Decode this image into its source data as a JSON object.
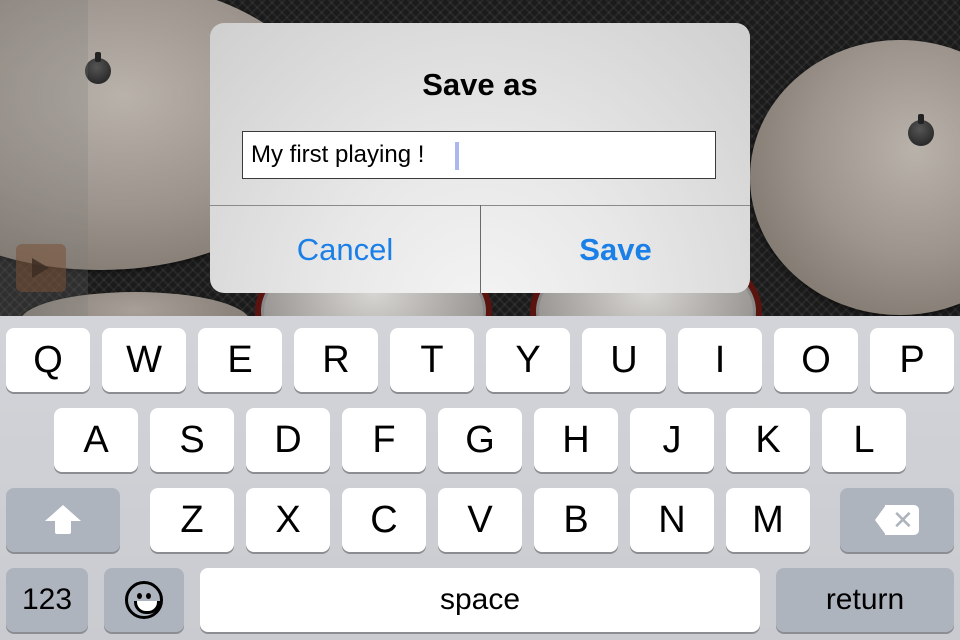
{
  "dialog": {
    "title": "Save as",
    "input_value": "My first playing ! ",
    "cancel_label": "Cancel",
    "save_label": "Save",
    "button_color": "#1a7fe6"
  },
  "background": {
    "description": "drum kit with cymbals on diamond plate",
    "icons": [
      "play-icon"
    ]
  },
  "keyboard": {
    "row1": [
      "Q",
      "W",
      "E",
      "R",
      "T",
      "Y",
      "U",
      "I",
      "O",
      "P"
    ],
    "row2": [
      "A",
      "S",
      "D",
      "F",
      "G",
      "H",
      "J",
      "K",
      "L"
    ],
    "row3": [
      "Z",
      "X",
      "C",
      "V",
      "B",
      "N",
      "M"
    ],
    "shift_icon": "shift-arrow-icon",
    "delete_icon": "backspace-icon",
    "numbers_label": "123",
    "emoji_icon": "emoji-icon",
    "space_label": "space",
    "return_label": "return"
  }
}
